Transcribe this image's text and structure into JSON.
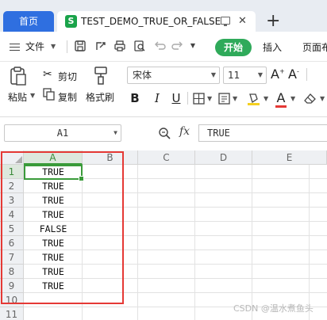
{
  "tabs": {
    "home_label": "首页",
    "doc_icon_letter": "S",
    "doc_title": "TEST_DEMO_TRUE_OR_FALSE",
    "close_glyph": "✕",
    "new_tab_glyph": "+"
  },
  "menu": {
    "file_label": "文件",
    "start_label": "开始",
    "insert_label": "插入",
    "layout_label": "页面布"
  },
  "ribbon": {
    "paste_label": "粘贴",
    "cut_label": "剪切",
    "copy_label": "复制",
    "format_painter_label": "格式刷",
    "font_name": "宋体",
    "font_size": "11",
    "bold": "B",
    "italic": "I",
    "underline": "U",
    "grow_font": "A",
    "shrink_font": "A",
    "font_color": "A",
    "font_color_swatch": "#e53935",
    "fill_color_swatch": "#f5d020"
  },
  "formula_bar": {
    "cell_ref": "A1",
    "fx_label": "fx",
    "value": "TRUE"
  },
  "sheet": {
    "columns": [
      "A",
      "B",
      "C",
      "D",
      "E"
    ],
    "rows": [
      "1",
      "2",
      "3",
      "4",
      "5",
      "6",
      "7",
      "8",
      "9",
      "10",
      "11"
    ],
    "column_a_values": [
      "TRUE",
      "TRUE",
      "TRUE",
      "TRUE",
      "FALSE",
      "TRUE",
      "TRUE",
      "TRUE",
      "TRUE",
      "",
      ""
    ],
    "highlight_color": "#e53935",
    "selection_color": "#3a9b3a"
  },
  "watermark": "CSDN @温水煮鱼头"
}
